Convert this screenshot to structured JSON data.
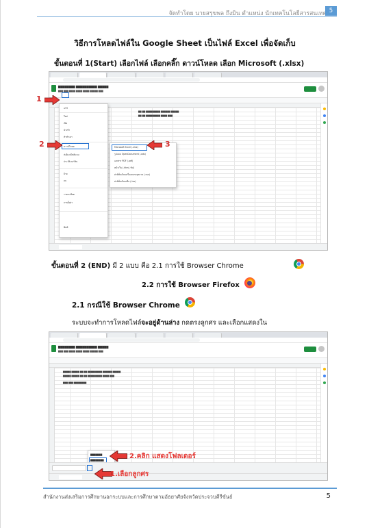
{
  "header": {
    "running_text": "จัดทำโดย นายสรุขพล ถึงมิน ตำแหน่ง นักเทคโนโลยีสารสนเทศ",
    "page_badge": "5"
  },
  "title": "วิธีการโหลดไฟล์ใน Google Sheet เป็นไฟล์ Excel เพื่อจัดเก็บ",
  "step1": {
    "lead": "ขั้นตอนที่ ",
    "text": "1(Start) เลือกไฟล์  เลือกคลิ๊ก ดาวน์โหลด เลือก Microsoft (.xlsx)"
  },
  "screenshot1": {
    "file_menu": {
      "items": [
        "แชร์",
        "ใหม่",
        "เปิด",
        "นำเข้า",
        "ทำสำเนา",
        "ดาวน์โหลด",
        "ส่งอีเมลไฟล์แนบ",
        "ประวัติเวอร์ชัน",
        "ย้าย",
        "ลบ",
        "รายละเอียด",
        "การตั้งค่า",
        "พิมพ์"
      ]
    },
    "download_menu": {
      "items": [
        "Microsoft Excel (.xlsx)",
        "รูปแบบ OpenDocument (.ods)",
        "เอกสาร PDF (.pdf)",
        "หน้าเว็บ (.html, ซิป)",
        "ค่าที่คั่นด้วยเครื่องหมายจุลภาค (.csv)",
        "ค่าที่คั่นด้วยแท็บ (.tsv)"
      ]
    },
    "callouts": [
      "1",
      "2",
      "3"
    ]
  },
  "step2": {
    "lead": "ขั้นตอนที่ 2 (END)",
    "text": "  มี 2 แบบ คือ 2.1 การใช้ Browser Chrome",
    "line2": "2.2 การใช้ Browser Firefox"
  },
  "section21": {
    "title": "2.1  กรณีใช้ Browser Chrome",
    "desc_pre": "ระบบจะทำการโหลดไฟล์",
    "desc_bold": "จะอยู่ด้านล่าง",
    "desc_post": " กดตรงลูกศร และเลือกแสดงใน"
  },
  "screenshot2": {
    "callout_folder": "2.คลิก แสดงโฟลเดอร์",
    "callout_arrow": "1.เลือกลูกศร"
  },
  "footer": {
    "text": "สำนักงานส่งเสริมการศึกษานอกระบบและการศึกษาตามอัธยาศัยจังหวัดประจวบคีรีขันธ์",
    "page": "5"
  },
  "colors": {
    "accent_blue": "#5b9bd5",
    "callout_red": "#d32f2f",
    "sheets_green": "#1e8e3e"
  }
}
